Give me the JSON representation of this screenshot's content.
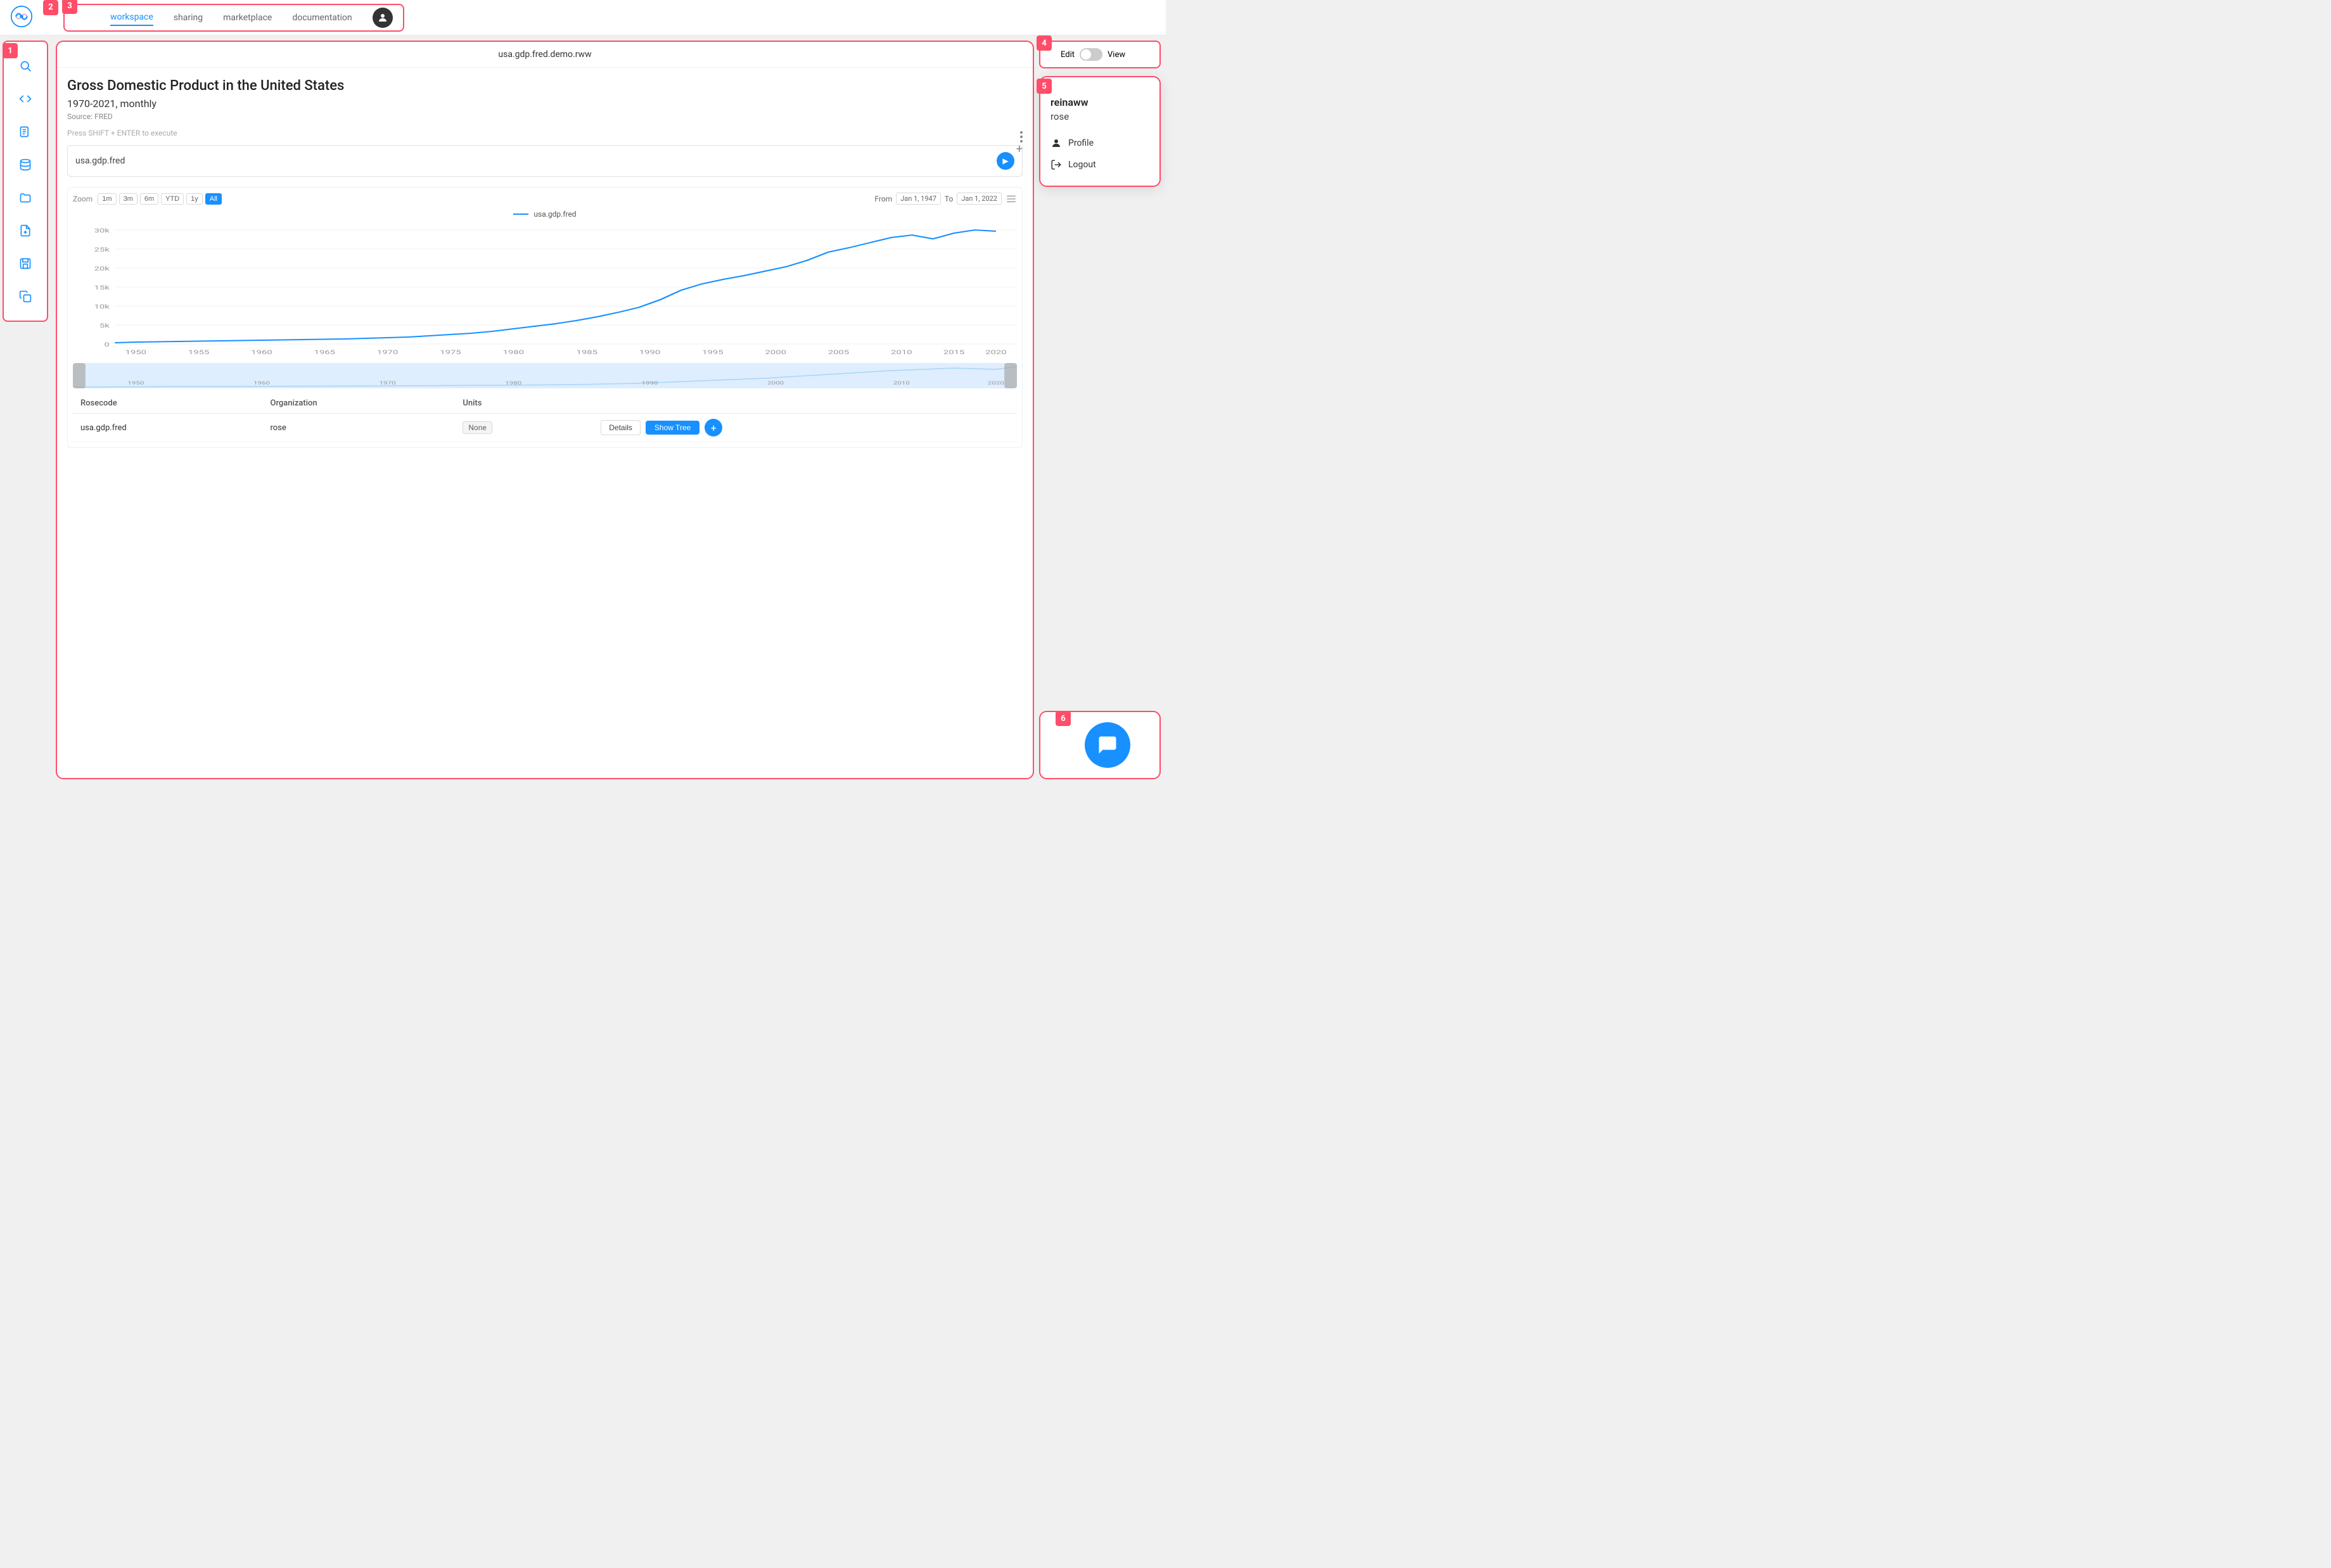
{
  "header": {
    "logo_alt": "App Logo",
    "nav": {
      "tabs": [
        {
          "id": "workspace",
          "label": "workspace",
          "active": true
        },
        {
          "id": "sharing",
          "label": "sharing",
          "active": false
        },
        {
          "id": "marketplace",
          "label": "marketplace",
          "active": false
        },
        {
          "id": "documentation",
          "label": "documentation",
          "active": false
        }
      ]
    }
  },
  "section_labels": [
    "1",
    "2",
    "3",
    "4",
    "5",
    "6"
  ],
  "sidebar": {
    "items": [
      {
        "id": "search",
        "icon": "🔍",
        "label": "Search"
      },
      {
        "id": "code",
        "icon": "<>",
        "label": "Code"
      },
      {
        "id": "document",
        "icon": "📄",
        "label": "Documents"
      },
      {
        "id": "database",
        "icon": "🗄",
        "label": "Database"
      },
      {
        "id": "folder",
        "icon": "📁",
        "label": "Folder"
      },
      {
        "id": "new-file",
        "icon": "📄+",
        "label": "New File"
      },
      {
        "id": "save",
        "icon": "💾",
        "label": "Save"
      },
      {
        "id": "copy",
        "icon": "📋",
        "label": "Copy"
      }
    ]
  },
  "workspace": {
    "panel_title": "usa.gdp.fred.demo.rww",
    "chart_title": "Gross Domestic Product in the United States",
    "chart_subtitle": "1970-2021, monthly",
    "chart_source": "Source: FRED",
    "execute_hint": "Press SHIFT + ENTER to execute",
    "query_value": "usa.gdp.fred",
    "run_button_label": "▶",
    "zoom": {
      "label": "Zoom",
      "options": [
        "1m",
        "3m",
        "6m",
        "YTD",
        "1y",
        "All"
      ],
      "active": "All"
    },
    "date_from_label": "From",
    "date_from": "Jan 1, 1947",
    "date_to_label": "To",
    "date_to": "Jan 1, 2022",
    "legend_label": "usa.gdp.fred",
    "y_axis": [
      "30k",
      "25k",
      "20k",
      "15k",
      "10k",
      "5k",
      "0"
    ],
    "x_axis": [
      "1950",
      "1955",
      "1960",
      "1965",
      "1970",
      "1975",
      "1980",
      "1985",
      "1990",
      "1995",
      "2000",
      "2005",
      "2010",
      "2015",
      "2020"
    ],
    "table": {
      "headers": [
        "Rosecode",
        "Organization",
        "Units",
        "",
        "",
        ""
      ],
      "rows": [
        {
          "rosecode": "usa.gdp.fred",
          "organization": "rose",
          "units": "None",
          "details_label": "Details",
          "show_tree_label": "Show Tree"
        }
      ]
    }
  },
  "edit_view": {
    "edit_label": "Edit",
    "view_label": "View",
    "toggle_state": false
  },
  "user_dropdown": {
    "username": "reinaww",
    "org": "rose",
    "profile_label": "Profile",
    "logout_label": "Logout"
  },
  "chat": {
    "icon": "💬"
  }
}
